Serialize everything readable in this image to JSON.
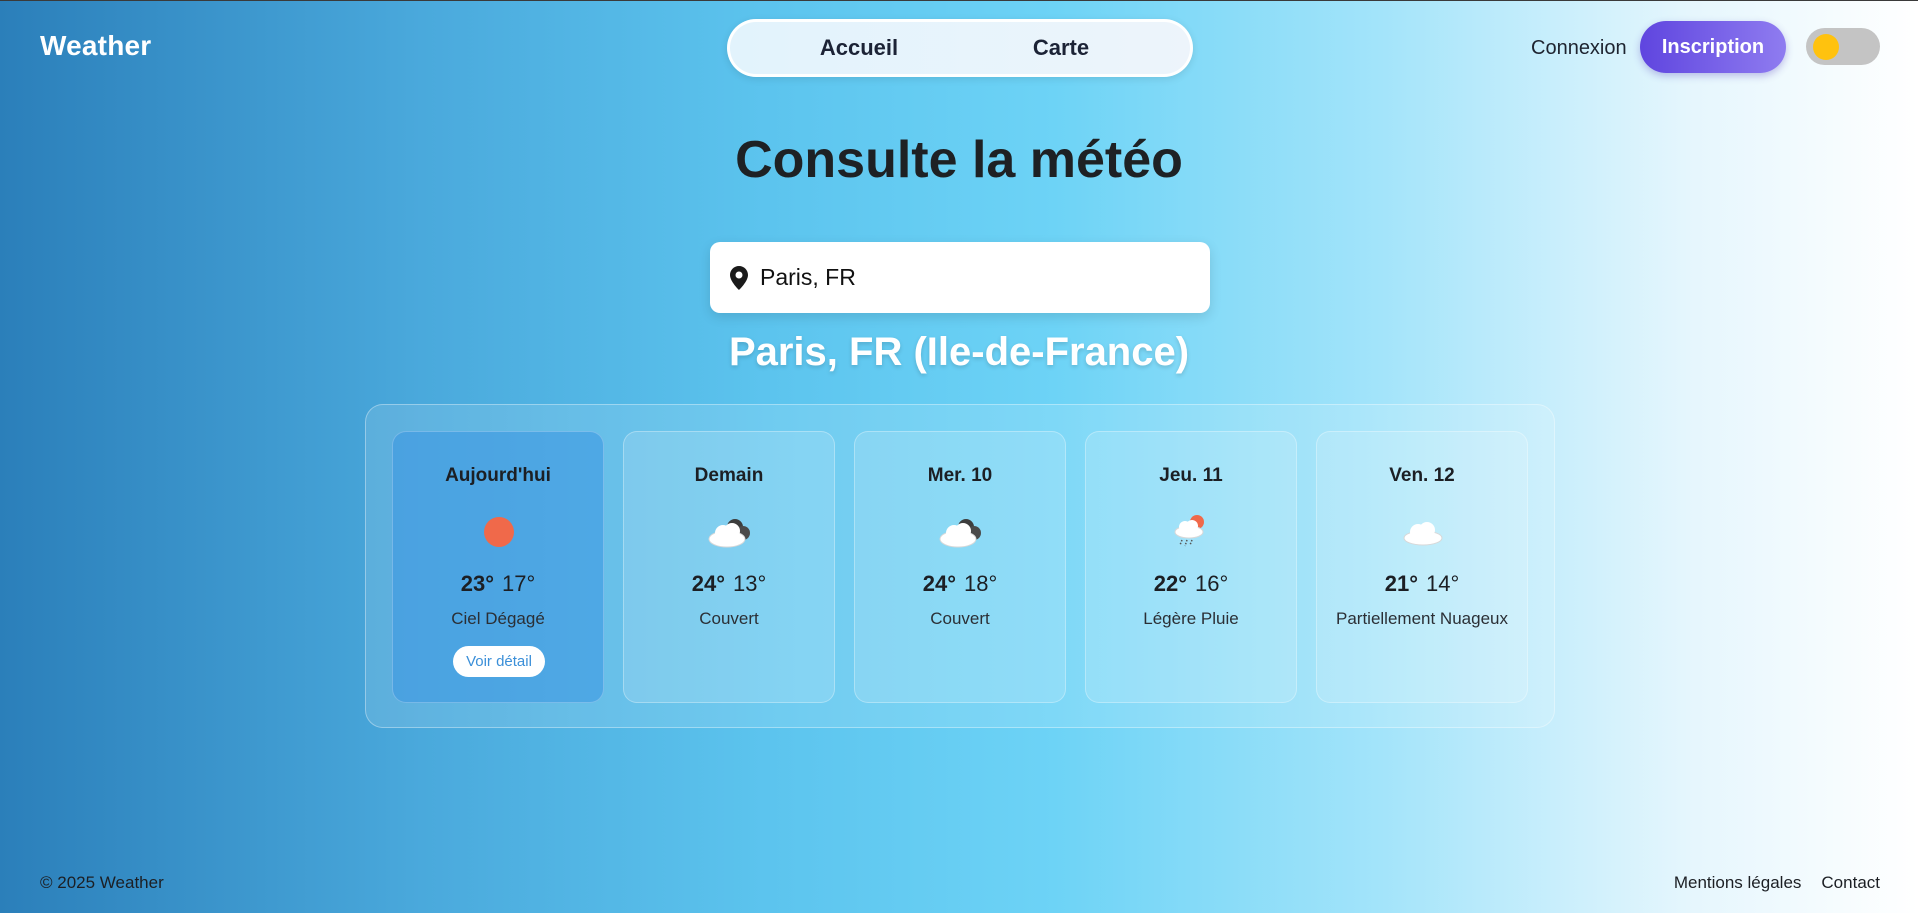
{
  "header": {
    "brand": "Weather",
    "nav_tabs": [
      {
        "label": "Accueil"
      },
      {
        "label": "Carte"
      }
    ],
    "login_label": "Connexion",
    "signup_label": "Inscription",
    "theme_toggle_icon": "sun-toggle"
  },
  "hero": {
    "title": "Consulte la météo"
  },
  "search": {
    "value": "Paris, FR",
    "icon": "map-pin-icon"
  },
  "location": {
    "title": "Paris, FR (Ile-de-France)"
  },
  "forecast": {
    "days": [
      {
        "name": "Aujourd'hui",
        "max": "23°",
        "min": "17°",
        "description": "Ciel Dégagé",
        "icon": "sun-icon",
        "detail_label": "Voir détail",
        "active": true
      },
      {
        "name": "Demain",
        "max": "24°",
        "min": "13°",
        "description": "Couvert",
        "icon": "overcast-cloud-icon"
      },
      {
        "name": "Mer. 10",
        "max": "24°",
        "min": "18°",
        "description": "Couvert",
        "icon": "overcast-cloud-icon"
      },
      {
        "name": "Jeu. 11",
        "max": "22°",
        "min": "16°",
        "description": "Légère Pluie",
        "icon": "sun-rain-cloud-icon"
      },
      {
        "name": "Ven. 12",
        "max": "21°",
        "min": "14°",
        "description": "Partiellement Nuageux",
        "icon": "cloud-icon"
      }
    ]
  },
  "colors": {
    "accent": "#5f45df",
    "sun": "#f0694a",
    "toggle_knob": "#ffc20e"
  },
  "footer": {
    "copyright": "© 2025 Weather",
    "links": [
      "Mentions légales",
      "Contact"
    ]
  }
}
